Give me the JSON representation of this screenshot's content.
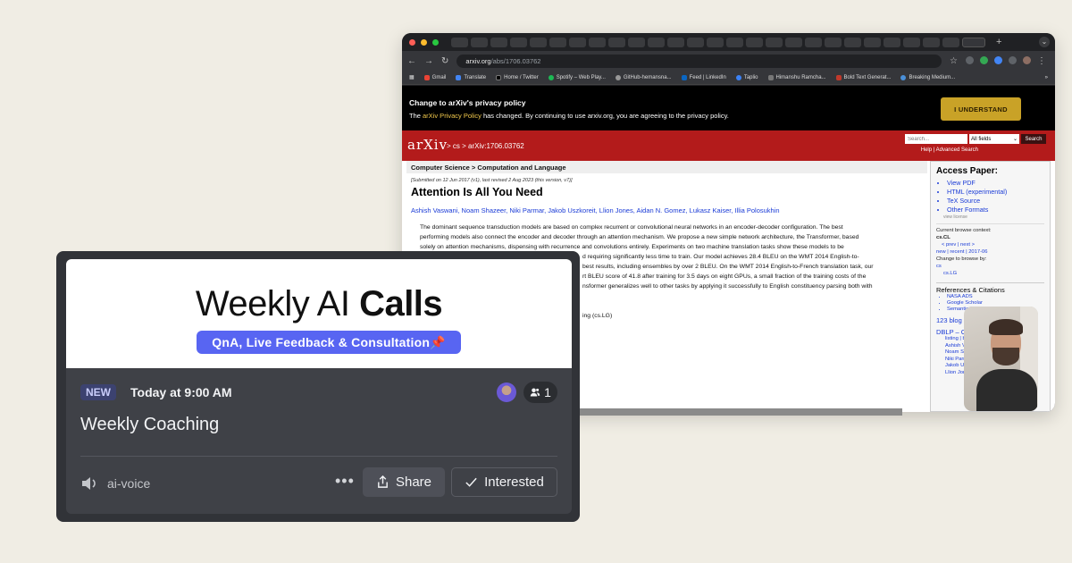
{
  "browser": {
    "url_host": "arxiv.org",
    "url_path": "/abs/1706.03762",
    "bookmarks": [
      "Gmail",
      "Translate",
      "Home / Twitter",
      "Spotify – Web Play...",
      "GitHub-hemansna...",
      "Feed | LinkedIn",
      "Taplio",
      "Himanshu Ramcha...",
      "Bold Text Generat...",
      "Breaking Medium..."
    ],
    "traffic_colors": [
      "#ff5f57",
      "#febc2e",
      "#28c840"
    ]
  },
  "arxiv": {
    "privacy_heading": "Change to arXiv's privacy policy",
    "privacy_prefix": "The ",
    "privacy_link": "arXiv Privacy Policy",
    "privacy_suffix": " has changed. By continuing to use arxiv.org, you are agreeing to the privacy policy.",
    "understand_label": "I UNDERSTAND",
    "logo": "arXiv",
    "breadcrumb": "> cs > arXiv:1706.03762",
    "search_placeholder": "Search...",
    "search_field": "All fields",
    "search_button": "Search",
    "help_links": "Help | Advanced Search",
    "subject": "Computer Science > Computation and Language",
    "submitted": "[Submitted on 12 Jun 2017 (v1), last revised 2 Aug 2023 (this version, v7)]",
    "title": "Attention Is All You Need",
    "authors": "Ashish Vaswani, Noam Shazeer, Niki Parmar, Jakob Uszkoreit, Llion Jones, Aidan N. Gomez, Lukasz Kaiser, Illia Polosukhin",
    "abstract_lines": [
      "The dominant sequence transduction models are based on complex recurrent or convolutional neural networks in an encoder-decoder configuration. The best",
      "performing models also connect the encoder and decoder through an attention mechanism. We propose a new simple network architecture, the Transformer, based",
      "solely on attention mechanisms, dispensing with recurrence and convolutions entirely. Experiments on two machine translation tasks show these models to be",
      "d requiring significantly less time to train. Our model achieves 28.4 BLEU on the WMT 2014 English-to-",
      "best results, including ensembles by over 2 BLEU. On the WMT 2014 English-to-French translation task, our",
      "rt BLEU score of 41.8 after training for 3.5 days on eight GPUs, a small fraction of the training costs of the",
      "nsformer generalizes well to other tasks by applying it successfully to English constituency parsing both with"
    ],
    "subject_tail": "ing (cs.LG)",
    "sidebar": {
      "heading": "Access Paper:",
      "links": [
        "View PDF",
        "HTML (experimental)",
        "TeX Source",
        "Other Formats"
      ],
      "license": "view license",
      "context_label": "Current browse context:",
      "context_value": "cs.CL",
      "prev_next": "< prev   |   next >",
      "new_recent": "new | recent | 2017-06",
      "change_label": "Change to browse by:",
      "change_values": [
        "cs",
        "cs.LG"
      ],
      "refs_heading": "References & Citations",
      "refs": [
        "NASA ADS",
        "Google Scholar",
        "Semantic Scholar"
      ],
      "blog": "123 blog links",
      "dblp": "DBLP – CS Bibliography",
      "dblp_items": [
        "listing | bibtex",
        "Ashish Vaswani",
        "Noam Shazeer",
        "Niki Parmar",
        "Jakob Uszkoreit",
        "Llion Jones"
      ]
    }
  },
  "event": {
    "banner_light": "Weekly AI ",
    "banner_bold": "Calls",
    "banner_pill": "QnA, Live Feedback & Consultation📌",
    "badge": "NEW",
    "time": "Today at 9:00 AM",
    "attendees": "1",
    "title": "Weekly Coaching",
    "channel": "ai-voice",
    "more": "•••",
    "share_label": "Share",
    "interested_label": "Interested",
    "accent": "#5865f2"
  }
}
